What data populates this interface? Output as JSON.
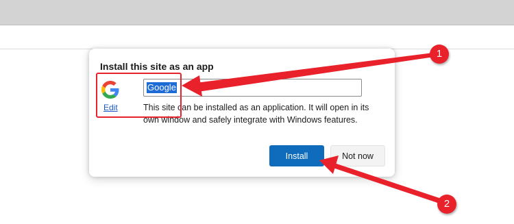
{
  "dialog": {
    "title": "Install this site as an app",
    "app_name_value": "Google",
    "edit_label": "Edit",
    "description": "This site can be installed as an application. It will open in its own window and safely integrate with Windows features.",
    "install_label": "Install",
    "not_now_label": "Not now",
    "site_icon": "google-g-icon"
  },
  "annotations": {
    "step_1": "1",
    "step_2": "2",
    "accent_color": "#e8212b"
  },
  "colors": {
    "primary_button": "#0f6cbd",
    "link": "#1a56c9",
    "selection": "#1e6bd6"
  }
}
